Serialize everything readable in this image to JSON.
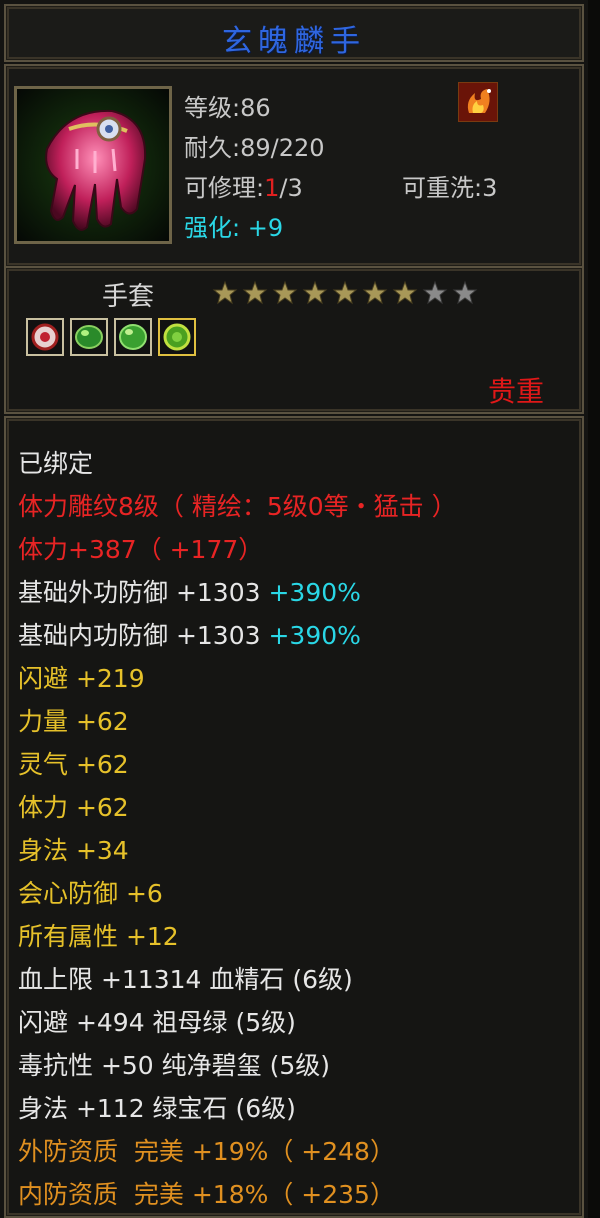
{
  "item": {
    "name": "玄魄麟手",
    "level": "等级:86",
    "durability": "耐久:89/220",
    "repair_prefix": "可修理:",
    "repair_used": "1",
    "repair_total": "/3",
    "reforge": "可重洗:3",
    "enhance_label": "强化:",
    "enhance_value": "+9",
    "type": "手套",
    "stars_filled": 7,
    "stars_total": 9,
    "rarity": "贵重"
  },
  "attributes": {
    "bound": "已绑定",
    "engrave": "体力雕纹8级（ 精绘：5级0等・猛击 ）",
    "stamina_bonus": "体力+387（ +177）",
    "outer_def": "基础外功防御 +1303 ",
    "outer_def_pct": "+390%",
    "inner_def": "基础内功防御 +1303 ",
    "inner_def_pct": "+390%",
    "dodge": "闪避 +219",
    "strength": "力量 +62",
    "spirit": "灵气 +62",
    "stamina": "体力 +62",
    "agility": "身法 +34",
    "crit_def": "会心防御 +6",
    "all_attr": "所有属性 +12",
    "gem1": "血上限 +11314 血精石 (6级)",
    "gem2": "闪避 +494 祖母绿 (5级)",
    "gem3": "毒抗性 +50 纯净碧玺 (5级)",
    "gem4": "身法 +112 绿宝石 (6级)",
    "outer_quality": "外防资质  完美 +19%（ +248）",
    "inner_quality": "内防资质  完美 +18%（ +235）"
  },
  "colors": {
    "title": "#2f66e0",
    "gold_text": "#e6c12a",
    "red_text": "#e82424",
    "cyan_text": "#2ad7e6",
    "orange_text": "#e09020"
  }
}
